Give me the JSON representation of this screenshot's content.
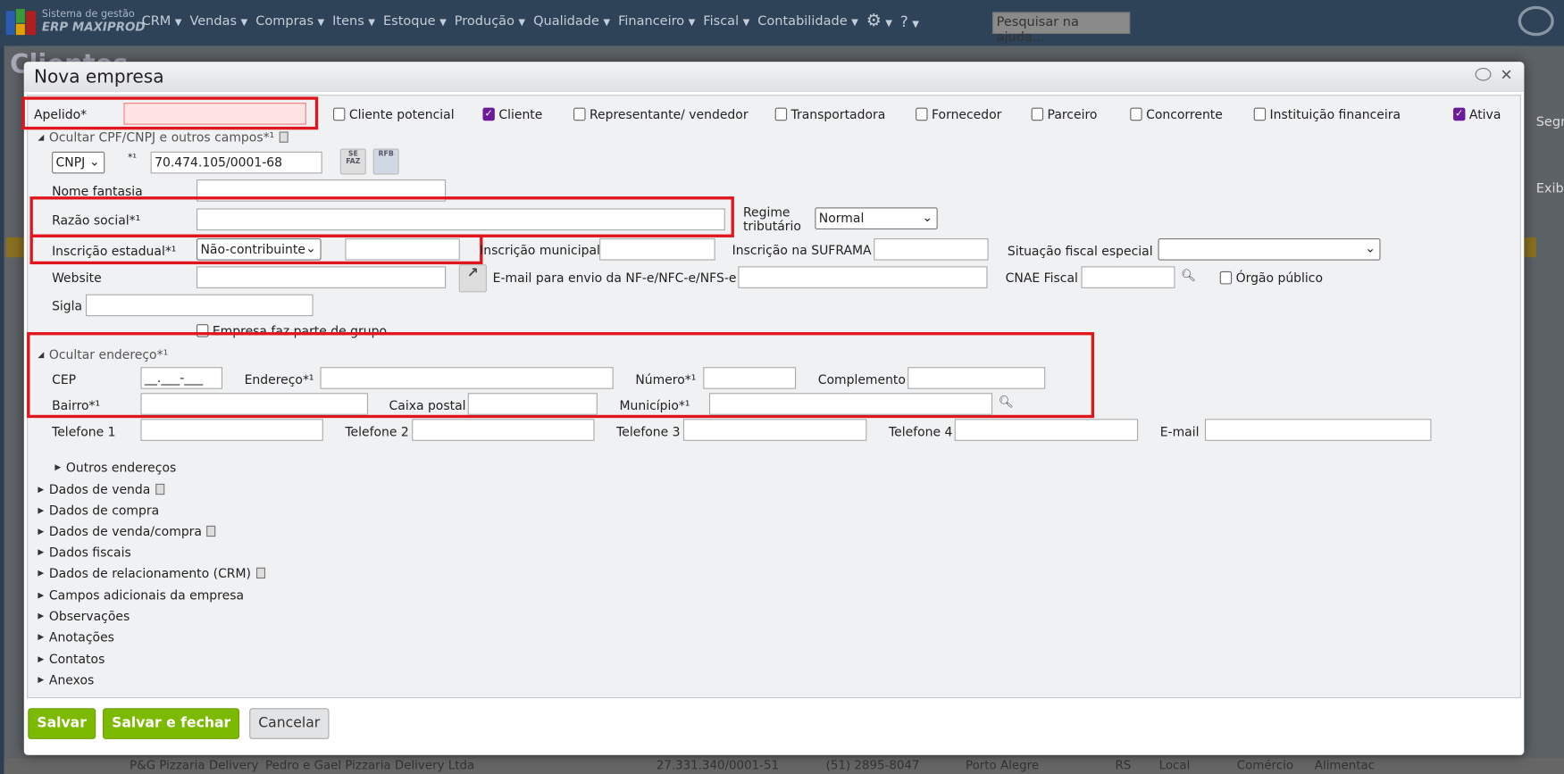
{
  "topbar": {
    "brand_line1": "Sistema de gestão",
    "brand_line2": "ERP MAXIPROD",
    "menu": [
      "CRM",
      "Vendas",
      "Compras",
      "Itens",
      "Estoque",
      "Produção",
      "Qualidade",
      "Financeiro",
      "Fiscal",
      "Contabilidade"
    ],
    "help_placeholder": "Pesquisar na ajuda..."
  },
  "background": {
    "page_title": "Clientes",
    "right_col1": "Segme",
    "right_col2": "Exibi",
    "row": [
      "P&G Pizzaria Delivery",
      "Pedro e Gael Pizzaria Delivery Ltda",
      "27.331.340/0001-51",
      "(51) 2895-8047",
      "Porto Alegre",
      "RS",
      "Local",
      "Comércio",
      "Alimentac"
    ]
  },
  "modal": {
    "title": "Nova empresa",
    "apelido_label": "Apelido*",
    "checkboxes": [
      {
        "label": "Cliente potencial",
        "checked": false
      },
      {
        "label": "Cliente",
        "checked": true
      },
      {
        "label": "Representante/ vendedor",
        "checked": false
      },
      {
        "label": "Transportadora",
        "checked": false
      },
      {
        "label": "Fornecedor",
        "checked": false
      },
      {
        "label": "Parceiro",
        "checked": false
      },
      {
        "label": "Concorrente",
        "checked": false
      },
      {
        "label": "Instituição financeira",
        "checked": false
      },
      {
        "label": "Ativa",
        "checked": true
      }
    ],
    "sec_cpf": "Ocultar CPF/CNPJ e outros campos*¹",
    "doc_type": "CNPJ",
    "doc_req": "*¹",
    "doc_value": "70.474.105/0001-68",
    "sefaz": "SE FAZ",
    "rfb": "RFB",
    "nome_fantasia": "Nome fantasia",
    "razao_social": "Razão social*¹",
    "regime_label": "Regime tributário",
    "regime_value": "Normal",
    "ie_label": "Inscrição estadual*¹",
    "ie_value": "Não-contribuinte",
    "im_label": "Inscrição municipal",
    "suframa_label": "Inscrição na SUFRAMA",
    "sit_label": "Situação fiscal especial",
    "website": "Website",
    "email_nf": "E-mail para envio da NF-e/NFC-e/NFS-e",
    "cnae": "CNAE Fiscal",
    "orgao": "Órgão público",
    "sigla": "Sigla",
    "grupo": "Empresa faz parte de grupo",
    "sec_end": "Ocultar endereço*¹",
    "cep": "CEP",
    "cep_mask": "__.___-___",
    "endereco": "Endereço*¹",
    "numero": "Número*¹",
    "complemento": "Complemento",
    "bairro": "Bairro*¹",
    "caixa": "Caixa postal",
    "municipio": "Município*¹",
    "tel1": "Telefone 1",
    "tel2": "Telefone 2",
    "tel3": "Telefone 3",
    "tel4": "Telefone 4",
    "email": "E-mail",
    "outros": "Outros endereços",
    "sections": [
      "Dados de venda",
      "Dados de compra",
      "Dados de venda/compra",
      "Dados fiscais",
      "Dados de relacionamento (CRM)",
      "Campos adicionais da empresa",
      "Observações",
      "Anotações",
      "Contatos",
      "Anexos"
    ],
    "save": "Salvar",
    "save_close": "Salvar e fechar",
    "cancel": "Cancelar"
  }
}
